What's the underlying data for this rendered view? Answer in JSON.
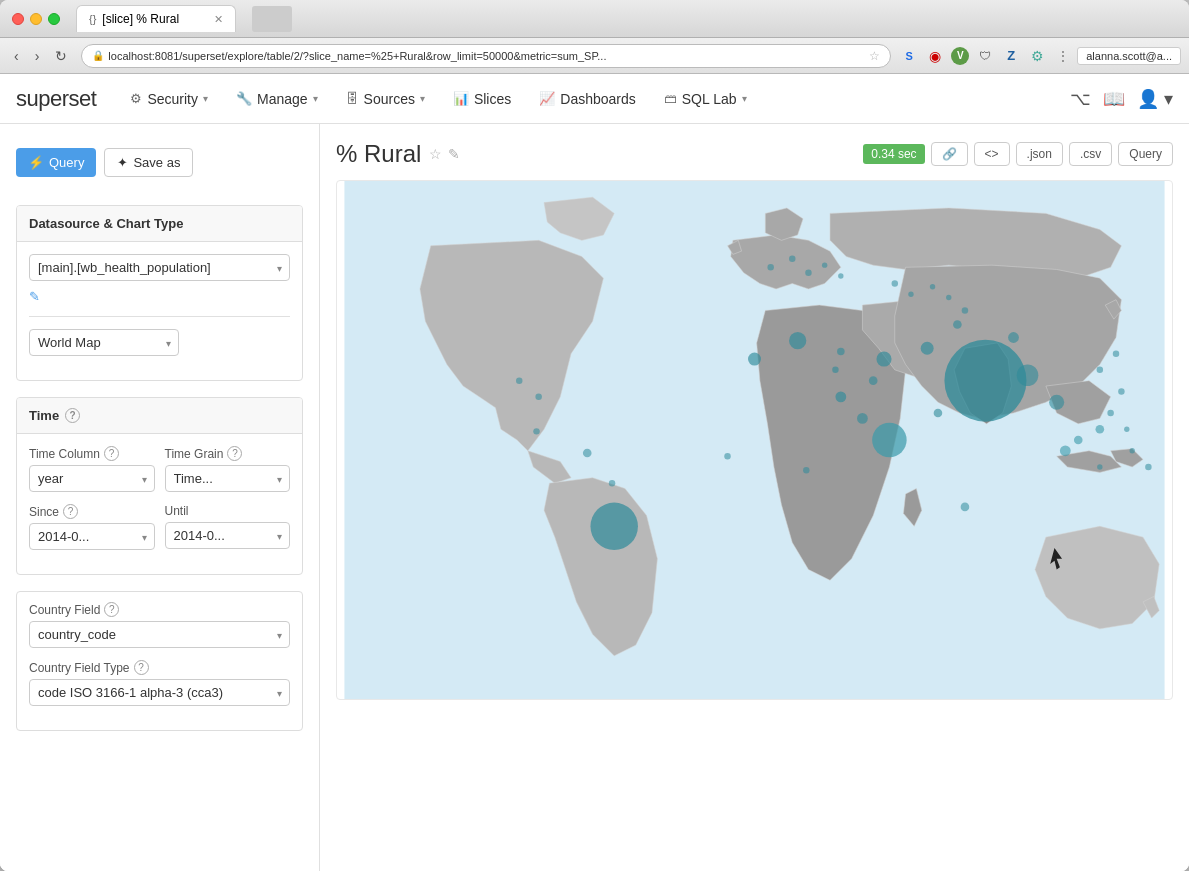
{
  "browser": {
    "tab_icon": "{}",
    "tab_title": "[slice] % Rural",
    "address": "localhost:8081/superset/explore/table/2/?slice_name=%25+Rural&row_limit=50000&metric=sum_SP...",
    "user": "alanna.scott@a..."
  },
  "nav": {
    "brand": "superset",
    "items": [
      {
        "id": "security",
        "label": "Security",
        "icon": "⚙",
        "has_dropdown": true
      },
      {
        "id": "manage",
        "label": "Manage",
        "icon": "🔧",
        "has_dropdown": true
      },
      {
        "id": "sources",
        "label": "Sources",
        "icon": "🗄",
        "has_dropdown": true
      },
      {
        "id": "slices",
        "label": "Slices",
        "icon": "📊",
        "has_dropdown": false
      },
      {
        "id": "dashboards",
        "label": "Dashboards",
        "icon": "📈",
        "has_dropdown": false
      },
      {
        "id": "sqllab",
        "label": "SQL Lab",
        "icon": "🗃",
        "has_dropdown": true
      }
    ]
  },
  "sidebar": {
    "query_label": "Query",
    "save_label": "Save as",
    "datasource_section": {
      "title": "Datasource & Chart Type",
      "datasource_value": "[main].[wb_health_population]",
      "datasource_options": [
        "[main].[wb_health_population]"
      ],
      "chart_type_value": "World Map",
      "chart_type_options": [
        "World Map"
      ]
    },
    "time_section": {
      "title": "Time",
      "time_column_label": "Time Column",
      "time_column_value": "year",
      "time_grain_label": "Time Grain",
      "time_grain_value": "Time...",
      "since_label": "Since",
      "since_value": "2014-0...",
      "until_label": "Until",
      "until_value": "2014-0..."
    },
    "query_section": {
      "country_field_label": "Country Field",
      "country_field_value": "country_code",
      "country_field_type_label": "Country Field Type",
      "country_field_type_value": "code ISO 3166-1 alpha-3 (cca3)"
    }
  },
  "chart": {
    "title": "% Rural",
    "timing": "0.34 sec",
    "toolbar_buttons": [
      "🔗",
      "<>",
      ".json",
      ".csv",
      "Query"
    ]
  },
  "colors": {
    "accent": "#4b9de8",
    "query_btn": "#4b9de8",
    "timing_badge": "#5cb85c",
    "map_land_default": "#c8c8c8",
    "map_land_dark": "#5a5a5a",
    "map_bubble": "#2e8b9a",
    "map_bg": "#e8f4f8"
  }
}
